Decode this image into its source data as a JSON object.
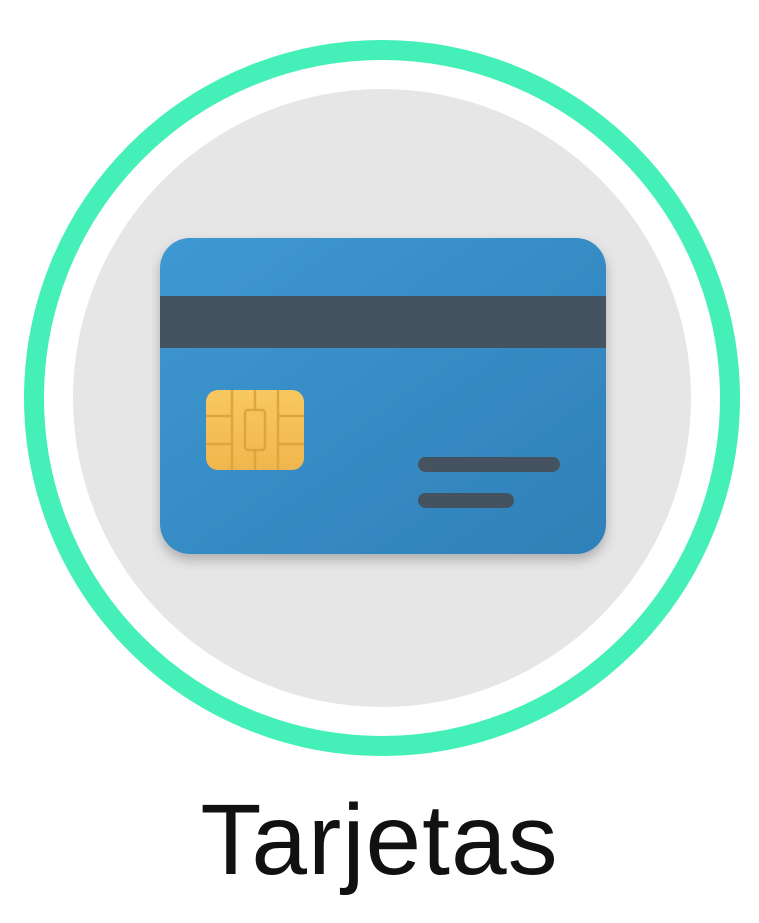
{
  "tile": {
    "label": "Tarjetas",
    "icon": "credit-card-icon"
  },
  "colors": {
    "ring": "#44efb8",
    "disc": "#e6e6e6",
    "card": "#3a8ec7",
    "stripe": "#45525f",
    "chip": "#f7c35c"
  }
}
